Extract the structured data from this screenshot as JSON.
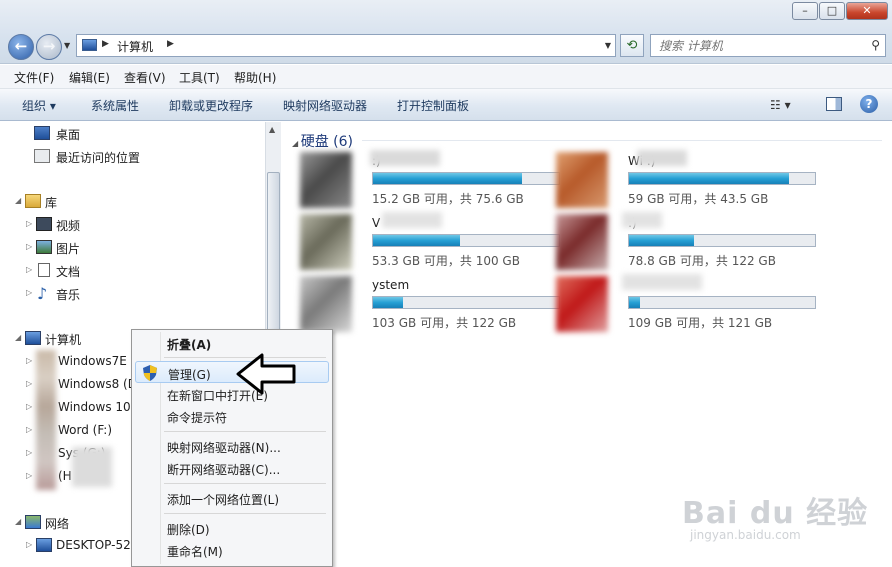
{
  "window": {
    "min": "–",
    "max": "□",
    "close": "✕"
  },
  "address": {
    "crumb": "计算机",
    "search_placeholder": "搜索 计算机"
  },
  "menubar": [
    "文件(F)",
    "编辑(E)",
    "查看(V)",
    "工具(T)",
    "帮助(H)"
  ],
  "toolbar": [
    "组织 ▾",
    "系统属性",
    "卸载或更改程序",
    "映射网络驱动器",
    "打开控制面板"
  ],
  "nav": {
    "desktop": "桌面",
    "recent": "最近访问的位置",
    "libraries": "库",
    "videos": "视频",
    "pictures": "图片",
    "documents": "文档",
    "music": "音乐",
    "computer": "计算机",
    "drives": [
      "Windows7E (C",
      "Windows8 (D",
      "Windows 10",
      "Word (F:)",
      "Sys     (G:)",
      "           (H"
    ],
    "network": "网络",
    "net_host": "DESKTOP-52"
  },
  "content": {
    "group": "硬盘 (6)",
    "drives": [
      {
        "name": ":)",
        "caption": "15.2 GB 可用，共 75.6 GB",
        "used": 0.8
      },
      {
        "name": "Wi        :)",
        "caption": "59 GB 可用，共 43.5 GB",
        "used": 0.86
      },
      {
        "name": "V",
        "caption": "53.3 GB 可用，共 100 GB",
        "used": 0.47
      },
      {
        "name": "  :)",
        "caption": "78.8 GB 可用，共 122 GB",
        "used": 0.35
      },
      {
        "name": "ystem",
        "caption": "103 GB 可用，共 122 GB",
        "used": 0.16
      },
      {
        "name": "",
        "caption": "109 GB 可用，共 121 GB",
        "used": 0.06
      }
    ]
  },
  "context_menu": {
    "collapse": "折叠(A)",
    "manage": "管理(G)",
    "open_new_window": "在新窗口中打开(E)",
    "cmd": "命令提示符",
    "map_drive": "映射网络驱动器(N)...",
    "disconnect_drive": "断开网络驱动器(C)...",
    "add_location": "添加一个网络位置(L)",
    "delete": "删除(D)",
    "rename": "重命名(M)"
  },
  "watermark": {
    "main": "Bai du 经验",
    "sub": "jingyan.baidu.com"
  },
  "colors": {
    "accent": "#26a0d4",
    "menu_hover": "#dcebfc"
  }
}
